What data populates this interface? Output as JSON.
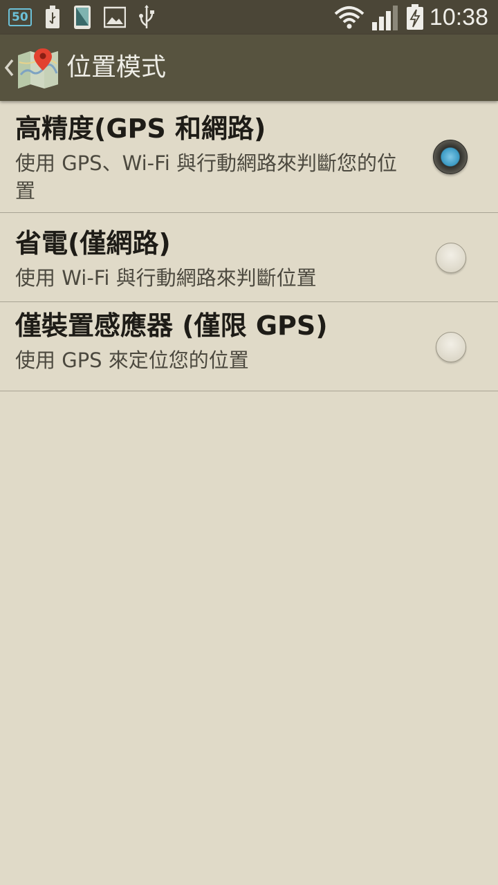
{
  "status_bar": {
    "badge_text": "50",
    "time": "10:38",
    "icons": [
      "usb-icon",
      "phone-screen-icon",
      "image-icon",
      "usb-icon",
      "wifi-icon",
      "signal-icon",
      "battery-charging-icon"
    ],
    "badge_color": "#6cc1d8"
  },
  "action_bar": {
    "title": "位置模式",
    "icon": "maps-icon",
    "back_icon": "chevron-left-icon"
  },
  "options": [
    {
      "title": "高精度(GPS 和網路)",
      "subtitle": "使用 GPS、Wi-Fi 與行動網路來判斷您的位置",
      "selected": true
    },
    {
      "title": "省電(僅網路)",
      "subtitle": "使用 Wi-Fi 與行動網路來判斷位置",
      "selected": false
    },
    {
      "title": "僅裝置感應器 (僅限 GPS)",
      "subtitle": "使用 GPS 來定位您的位置",
      "selected": false
    }
  ],
  "colors": {
    "background": "#e0dac8",
    "status_bar": "#4b4637",
    "action_bar": "#57533f",
    "radio_selected": "#3b9ac4"
  }
}
